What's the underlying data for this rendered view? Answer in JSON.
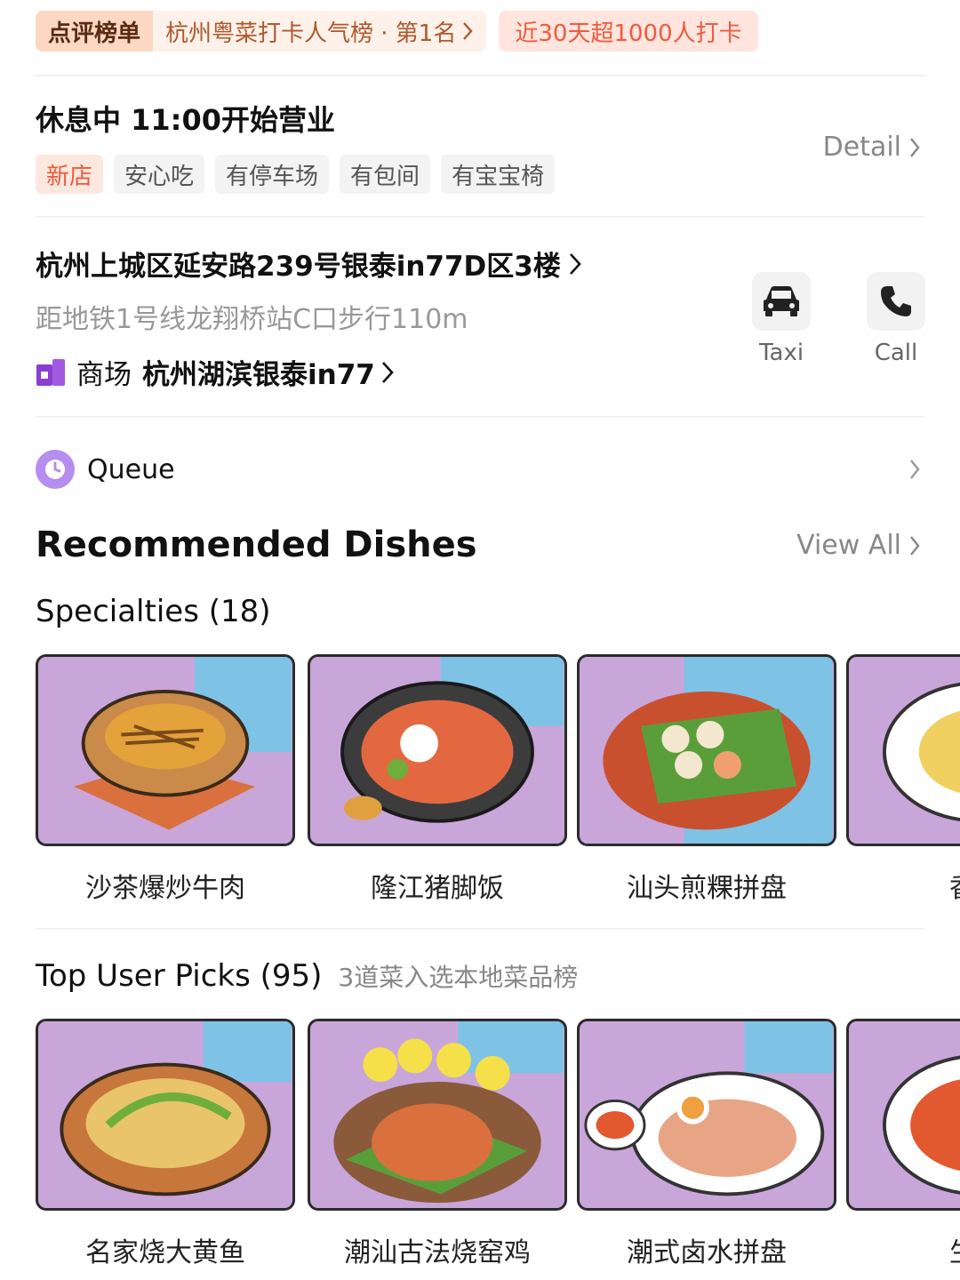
{
  "ranking": {
    "badge": "点评榜单",
    "text": "杭州粤菜打卡人气榜 · 第1名",
    "checkin": "近30天超1000人打卡"
  },
  "status": {
    "text": "休息中  11:00开始营业",
    "tags": [
      "新店",
      "安心吃",
      "有停车场",
      "有包间",
      "有宝宝椅"
    ],
    "detail": "Detail"
  },
  "location": {
    "address": "杭州上城区延安路239号银泰in77D区3楼",
    "metro": "距地铁1号线龙翔桥站C口步行110m",
    "mall_prefix": "商场",
    "mall_name": "杭州湖滨银泰in77"
  },
  "actions": {
    "taxi": "Taxi",
    "call": "Call"
  },
  "queue": {
    "label": "Queue"
  },
  "recommended": {
    "title": "Recommended Dishes",
    "view_all": "View All",
    "specialties": {
      "title": "Specialties (18)",
      "dishes": [
        "沙茶爆炒牛肉",
        "隆江猪脚饭",
        "汕头煎粿拼盘",
        "香煎"
      ]
    },
    "top_picks": {
      "title": "Top User Picks (95)",
      "note": "3道菜入选本地菜品榜",
      "dishes": [
        "名家烧大黄鱼",
        "潮汕古法烧窑鸡",
        "潮式卤水拼盘",
        "生腌"
      ]
    }
  },
  "colors": {
    "accent": "#ef5a3a",
    "queue_purple": "#b68ef0",
    "mall_purple": "#8a3fd1",
    "dish_bg_purple": "#c9a6d9",
    "dish_bg_blue": "#7ec3e6"
  }
}
